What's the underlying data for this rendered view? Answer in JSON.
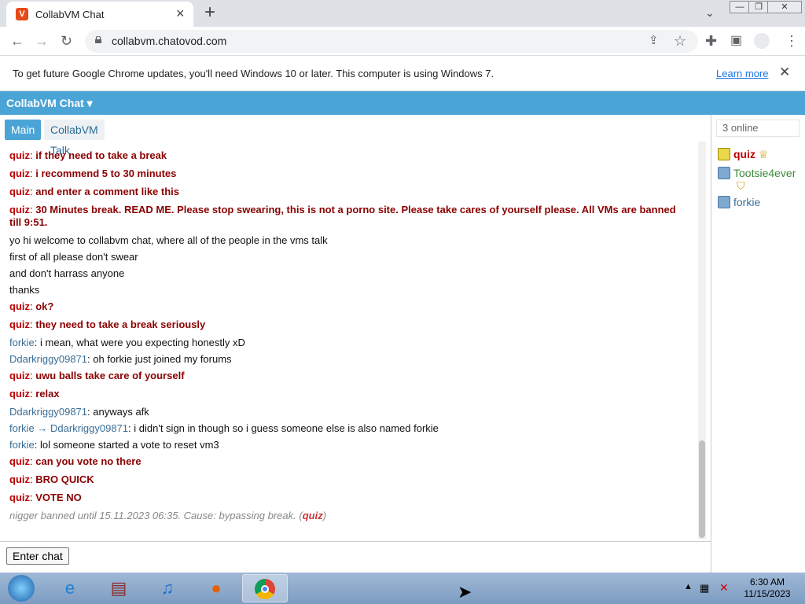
{
  "browser": {
    "tab_title": "CollabVM Chat",
    "url": "collabvm.chatovod.com",
    "infobar_text": "To get future Google Chrome updates, you'll need Windows 10 or later. This computer is using Windows 7.",
    "learn_more": "Learn more"
  },
  "app": {
    "title": "CollabVM Chat ▾",
    "tabs": [
      "Main",
      "CollabVM Talk"
    ],
    "enter_chat": "Enter chat"
  },
  "messages": [
    {
      "user": "quiz",
      "text": "if they need to take a break"
    },
    {
      "user": "quiz",
      "text": "i recommend 5 to 30 minutes"
    },
    {
      "user": "quiz",
      "text": "and enter a comment like this"
    },
    {
      "user": "quiz",
      "text": "30 Minutes break. READ ME. Please stop swearing, this is not a porno site. Please take cares of yourself please. All VMs are banned till 9:51."
    },
    {
      "plain": "yo hi welcome to collabvm chat, where all of the people in the vms talk\nfirst of all please don't swear\nand don't harrass anyone\nthanks"
    },
    {
      "user": "quiz",
      "text": "ok?"
    },
    {
      "user": "quiz",
      "text": "they need to take a break seriously"
    },
    {
      "user": "forkie",
      "text": "i mean, what were you expecting honestly xD"
    },
    {
      "user": "Ddarkriggy09871",
      "text": "oh forkie just joined my forums"
    },
    {
      "user": "quiz",
      "text": "uwu balls take care of yourself"
    },
    {
      "user": "quiz",
      "text": "relax"
    },
    {
      "user": "Ddarkriggy09871",
      "text": "anyways afk"
    },
    {
      "user": "forkie → Ddarkriggy09871",
      "text": "i didn't sign in though so i guess someone else is also named forkie"
    },
    {
      "user": "forkie",
      "text": "lol someone started a vote to reset vm3"
    },
    {
      "user": "quiz",
      "text": "can you vote no there"
    },
    {
      "user": "quiz",
      "text": "BRO QUICK"
    },
    {
      "user": "quiz",
      "text": "VOTE NO"
    }
  ],
  "system_message": {
    "text": "nigger banned until 15.11.2023 06:35. Cause: bypassing break. (",
    "by": "quiz",
    "end": ")"
  },
  "online_count": "3 online",
  "users": [
    {
      "name": "quiz",
      "color": "#b00"
    },
    {
      "name": "Tootsie4ever",
      "color": "#3a8a3a"
    },
    {
      "name": "forkie",
      "color": "#3a6e96"
    }
  ],
  "clock": {
    "time": "6:30 AM",
    "date": "11/15/2023"
  },
  "colors": {
    "accent": "#4ba4d6",
    "quiz": "#b00"
  }
}
